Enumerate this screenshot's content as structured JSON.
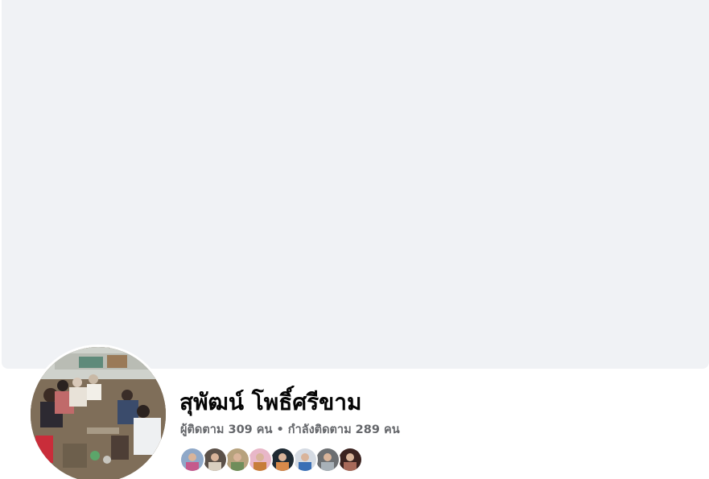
{
  "profile": {
    "name": "สุพัฒน์ โพธิ์ศรีขาม",
    "followers_text": "ผู้ติดตาม 309 คน",
    "separator": " • ",
    "following_text": "กำลังติดตาม 289 คน"
  },
  "friends": [
    {
      "icon": "friend-avatar-1",
      "color": "#8fa8c8",
      "accent": "#c55a8c"
    },
    {
      "icon": "friend-avatar-2",
      "color": "#5b5048",
      "accent": "#d9cfc0"
    },
    {
      "icon": "friend-avatar-3",
      "color": "#b7a27d",
      "accent": "#6f8d5a"
    },
    {
      "icon": "friend-avatar-4",
      "color": "#e8b7c8",
      "accent": "#c77d3a"
    },
    {
      "icon": "friend-avatar-5",
      "color": "#1f2a33",
      "accent": "#d88a4a"
    },
    {
      "icon": "friend-avatar-6",
      "color": "#d5dbe3",
      "accent": "#3a6fb5"
    },
    {
      "icon": "friend-avatar-7",
      "color": "#6c6f72",
      "accent": "#a8b1b8"
    },
    {
      "icon": "friend-avatar-8",
      "color": "#3b2320",
      "accent": "#a86a5a"
    }
  ],
  "colors": {
    "cover_bg": "#f0f2f5",
    "name_text": "#050505",
    "secondary_text": "#65676b"
  }
}
